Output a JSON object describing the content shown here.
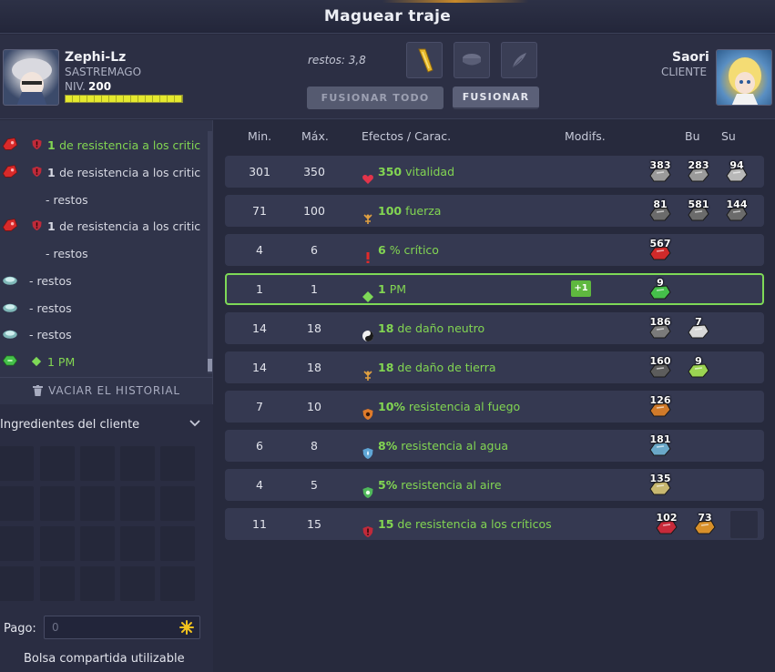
{
  "window": {
    "title": "Maguear traje"
  },
  "crafter": {
    "name": "Zephi-Lz",
    "role": "SASTREMAGO",
    "level_label": "NIV.",
    "level": "200",
    "xp_fraction": 1.0
  },
  "client": {
    "name": "Saori",
    "role": "CLIENTE"
  },
  "restos": "restos: 3,8",
  "buttons": {
    "fuse_all": "FUSIONAR TODO",
    "fuse": "FUSIONAR"
  },
  "history": {
    "items": [
      {
        "icon": "red-rune-icon",
        "prefix": "1",
        "text": "de resistencia a los critic",
        "green": true
      },
      {
        "icon": "red-rune-icon",
        "prefix": "1",
        "text": "de resistencia a los critic",
        "green": false
      },
      {
        "icon": "",
        "prefix": "",
        "text": "- restos",
        "green": false
      },
      {
        "icon": "red-rune-icon",
        "prefix": "1",
        "text": "de resistencia a los critic",
        "green": false
      },
      {
        "icon": "",
        "prefix": "",
        "text": "- restos",
        "green": false
      },
      {
        "icon": "teal-rune-icon",
        "prefix": "",
        "text": "- restos",
        "green": false
      },
      {
        "icon": "teal-rune-icon",
        "prefix": "",
        "text": "- restos",
        "green": false
      },
      {
        "icon": "teal-rune-icon",
        "prefix": "",
        "text": "- restos",
        "green": false
      },
      {
        "icon": "green-rune-icon",
        "prefix": "",
        "text": "1 PM",
        "green": true
      }
    ],
    "clear_label": "VACIAR EL HISTORIAL"
  },
  "ingredients": {
    "title": "Ingredientes del cliente",
    "payment_label": "Pago:",
    "payment_value": "0",
    "shared_bag": "Bolsa compartida utilizable"
  },
  "table": {
    "headers": {
      "min": "Min.",
      "max": "Máx.",
      "effects": "Efectos / Carac.",
      "modifs": "Modifs.",
      "bu": "Bu",
      "su": "Su"
    },
    "rows": [
      {
        "min": "301",
        "max": "350",
        "icon": "heart-icon",
        "value": "350",
        "name": "vitalidad",
        "modif": "",
        "highlight": false,
        "runes": [
          {
            "count": "383",
            "color": "#9a9a9a"
          },
          {
            "count": "283",
            "color": "#9a9a9a"
          },
          {
            "count": "94",
            "color": "#b8b8b8"
          }
        ]
      },
      {
        "min": "71",
        "max": "100",
        "icon": "earth-icon",
        "value": "100",
        "name": "fuerza",
        "modif": "",
        "highlight": false,
        "runes": [
          {
            "count": "81",
            "color": "#6b6b6b"
          },
          {
            "count": "581",
            "color": "#6b6b6b"
          },
          {
            "count": "144",
            "color": "#6b6b6b"
          }
        ]
      },
      {
        "min": "4",
        "max": "6",
        "icon": "critical-icon",
        "value": "6",
        "name": "% crítico",
        "modif": "",
        "highlight": false,
        "runes": [
          {
            "count": "567",
            "color": "#d02a2a"
          }
        ]
      },
      {
        "min": "1",
        "max": "1",
        "icon": "pm-icon",
        "value": "1",
        "name": "PM",
        "modif": "+1",
        "highlight": true,
        "runes": [
          {
            "count": "9",
            "color": "#45c04a"
          }
        ]
      },
      {
        "min": "14",
        "max": "18",
        "icon": "neutral-icon",
        "value": "18",
        "name": "de daño neutro",
        "modif": "",
        "highlight": false,
        "runes": [
          {
            "count": "186",
            "color": "#7a7a7a"
          },
          {
            "count": "7",
            "color": "#d8d8d8"
          }
        ]
      },
      {
        "min": "14",
        "max": "18",
        "icon": "earth-icon",
        "value": "18",
        "name": "de daño de tierra",
        "modif": "",
        "highlight": false,
        "runes": [
          {
            "count": "160",
            "color": "#5c5c5c"
          },
          {
            "count": "9",
            "color": "#9bd452"
          }
        ]
      },
      {
        "min": "7",
        "max": "10",
        "icon": "fire-shield-icon",
        "value": "10%",
        "name": "resistencia al fuego",
        "modif": "",
        "highlight": false,
        "runes": [
          {
            "count": "126",
            "color": "#d07a2a"
          }
        ]
      },
      {
        "min": "6",
        "max": "8",
        "icon": "water-shield-icon",
        "value": "8%",
        "name": "resistencia al agua",
        "modif": "",
        "highlight": false,
        "runes": [
          {
            "count": "181",
            "color": "#6aa8c8"
          }
        ]
      },
      {
        "min": "4",
        "max": "5",
        "icon": "air-shield-icon",
        "value": "5%",
        "name": "resistencia al aire",
        "modif": "",
        "highlight": false,
        "runes": [
          {
            "count": "135",
            "color": "#c8b870"
          }
        ]
      },
      {
        "min": "11",
        "max": "15",
        "icon": "critical-shield-icon",
        "value": "15",
        "name": "de resistencia a los críticos",
        "modif": "",
        "highlight": false,
        "runes": [
          {
            "count": "102",
            "color": "#c82a3a"
          },
          {
            "count": "73",
            "color": "#d8902a"
          }
        ]
      }
    ]
  },
  "colors": {
    "accent_green": "#82d552",
    "highlight_border": "#7ed957",
    "row_bg": "#353951",
    "panel_bg": "#272a3d"
  }
}
